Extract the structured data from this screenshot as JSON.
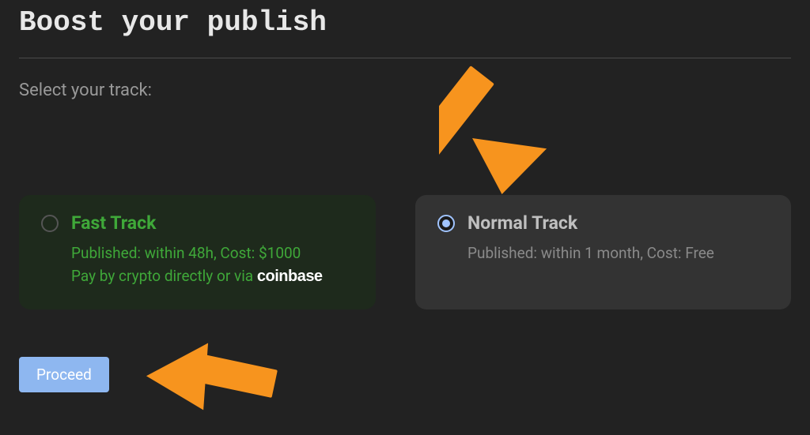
{
  "title": "Boost your publish",
  "subtitle": "Select your track:",
  "tracks": {
    "fast": {
      "title": "Fast Track",
      "line1": "Published: within 48h, Cost: $1000",
      "payPrefix": "Pay by crypto directly or via ",
      "payBrand": "coinbase"
    },
    "normal": {
      "title": "Normal Track",
      "line1": "Published: within 1 month, Cost: Free"
    }
  },
  "proceed": "Proceed"
}
